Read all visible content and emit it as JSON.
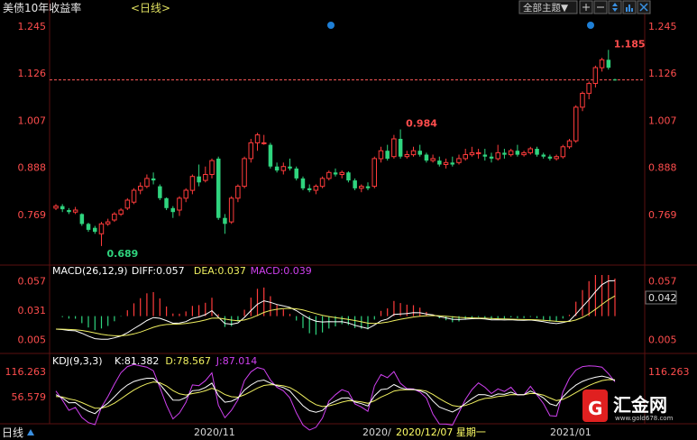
{
  "header": {
    "title": "美债10年收益率",
    "period": "<日线>",
    "theme_button": "全部主题▼",
    "period_label": "日线"
  },
  "colors": {
    "up": "#ff3b3b",
    "down": "#2fd47e",
    "axis_red": "#ff4d4d",
    "macd_yellow": "#f0f060",
    "macd_pink": "#e040fb",
    "k_white": "#ffffff",
    "d_yellow": "#f0f060",
    "j_purple": "#d040f0",
    "dashed_red": "#ff5a5a",
    "grid": "#3a0a0a",
    "marker_blue": "#1e7fd6"
  },
  "chart_data": [
    {
      "type": "candlestick",
      "title": "美债10年收益率",
      "yticks": [
        "1.245",
        "1.126",
        "1.007",
        "0.888",
        "0.769"
      ],
      "ylim": [
        0.65,
        1.27
      ],
      "current_line": 1.109,
      "current_label": "1.126",
      "annotations": [
        {
          "label": "0.689",
          "value": 0.689
        },
        {
          "label": "0.984",
          "value": 0.984
        },
        {
          "label": "1.185",
          "value": 1.185
        }
      ],
      "candles": [
        [
          0.785,
          0.79,
          0.795,
          0.78
        ],
        [
          0.79,
          0.782,
          0.795,
          0.775
        ],
        [
          0.78,
          0.775,
          0.785,
          0.77
        ],
        [
          0.775,
          0.78,
          0.788,
          0.77
        ],
        [
          0.77,
          0.745,
          0.772,
          0.74
        ],
        [
          0.745,
          0.73,
          0.748,
          0.725
        ],
        [
          0.735,
          0.725,
          0.74,
          0.72
        ],
        [
          0.72,
          0.745,
          0.75,
          0.689
        ],
        [
          0.745,
          0.75,
          0.758,
          0.74
        ],
        [
          0.755,
          0.77,
          0.775,
          0.75
        ],
        [
          0.77,
          0.78,
          0.785,
          0.765
        ],
        [
          0.785,
          0.805,
          0.81,
          0.78
        ],
        [
          0.8,
          0.83,
          0.835,
          0.795
        ],
        [
          0.83,
          0.84,
          0.85,
          0.82
        ],
        [
          0.84,
          0.86,
          0.87,
          0.835
        ],
        [
          0.86,
          0.855,
          0.875,
          0.845
        ],
        [
          0.84,
          0.81,
          0.845,
          0.805
        ],
        [
          0.81,
          0.785,
          0.812,
          0.78
        ],
        [
          0.785,
          0.775,
          0.79,
          0.76
        ],
        [
          0.78,
          0.81,
          0.815,
          0.765
        ],
        [
          0.81,
          0.83,
          0.835,
          0.8
        ],
        [
          0.83,
          0.865,
          0.87,
          0.82
        ],
        [
          0.865,
          0.85,
          0.895,
          0.84
        ],
        [
          0.855,
          0.87,
          0.89,
          0.85
        ],
        [
          0.87,
          0.905,
          0.91,
          0.86
        ],
        [
          0.91,
          0.76,
          0.915,
          0.755
        ],
        [
          0.76,
          0.745,
          0.77,
          0.72
        ],
        [
          0.75,
          0.81,
          0.815,
          0.745
        ],
        [
          0.81,
          0.84,
          0.845,
          0.8
        ],
        [
          0.84,
          0.91,
          0.915,
          0.835
        ],
        [
          0.91,
          0.95,
          0.96,
          0.9
        ],
        [
          0.95,
          0.97,
          0.975,
          0.93
        ],
        [
          0.95,
          0.95,
          0.97,
          0.945
        ],
        [
          0.945,
          0.89,
          0.95,
          0.885
        ],
        [
          0.89,
          0.88,
          0.9,
          0.875
        ],
        [
          0.88,
          0.89,
          0.9,
          0.87
        ],
        [
          0.89,
          0.885,
          0.91,
          0.88
        ],
        [
          0.885,
          0.86,
          0.89,
          0.855
        ],
        [
          0.86,
          0.835,
          0.865,
          0.83
        ],
        [
          0.835,
          0.83,
          0.845,
          0.825
        ],
        [
          0.83,
          0.84,
          0.845,
          0.82
        ],
        [
          0.84,
          0.86,
          0.865,
          0.835
        ],
        [
          0.86,
          0.875,
          0.88,
          0.855
        ],
        [
          0.875,
          0.87,
          0.885,
          0.865
        ],
        [
          0.87,
          0.875,
          0.88,
          0.86
        ],
        [
          0.875,
          0.855,
          0.878,
          0.85
        ],
        [
          0.855,
          0.835,
          0.86,
          0.83
        ],
        [
          0.835,
          0.84,
          0.845,
          0.825
        ],
        [
          0.84,
          0.835,
          0.85,
          0.83
        ],
        [
          0.84,
          0.91,
          0.915,
          0.835
        ],
        [
          0.91,
          0.93,
          0.94,
          0.9
        ],
        [
          0.93,
          0.91,
          0.945,
          0.905
        ],
        [
          0.915,
          0.96,
          0.97,
          0.91
        ],
        [
          0.96,
          0.915,
          0.984,
          0.91
        ],
        [
          0.915,
          0.92,
          0.93,
          0.91
        ],
        [
          0.92,
          0.93,
          0.94,
          0.915
        ],
        [
          0.93,
          0.92,
          0.945,
          0.915
        ],
        [
          0.92,
          0.905,
          0.925,
          0.9
        ],
        [
          0.905,
          0.91,
          0.92,
          0.9
        ],
        [
          0.905,
          0.895,
          0.915,
          0.89
        ],
        [
          0.895,
          0.9,
          0.91,
          0.885
        ],
        [
          0.9,
          0.895,
          0.915,
          0.89
        ],
        [
          0.9,
          0.91,
          0.92,
          0.895
        ],
        [
          0.91,
          0.92,
          0.935,
          0.905
        ],
        [
          0.92,
          0.925,
          0.94,
          0.915
        ],
        [
          0.925,
          0.925,
          0.935,
          0.91
        ],
        [
          0.92,
          0.915,
          0.935,
          0.905
        ],
        [
          0.915,
          0.91,
          0.925,
          0.9
        ],
        [
          0.91,
          0.925,
          0.945,
          0.905
        ],
        [
          0.925,
          0.92,
          0.935,
          0.91
        ],
        [
          0.92,
          0.93,
          0.935,
          0.915
        ],
        [
          0.93,
          0.92,
          0.945,
          0.915
        ],
        [
          0.92,
          0.925,
          0.93,
          0.915
        ],
        [
          0.925,
          0.935,
          0.94,
          0.92
        ],
        [
          0.935,
          0.92,
          0.94,
          0.915
        ],
        [
          0.92,
          0.915,
          0.925,
          0.91
        ],
        [
          0.915,
          0.91,
          0.92,
          0.905
        ],
        [
          0.91,
          0.915,
          0.92,
          0.905
        ],
        [
          0.915,
          0.94,
          0.945,
          0.91
        ],
        [
          0.94,
          0.955,
          0.96,
          0.935
        ],
        [
          0.955,
          1.04,
          1.045,
          0.95
        ],
        [
          1.04,
          1.075,
          1.08,
          1.03
        ],
        [
          1.075,
          1.1,
          1.105,
          1.06
        ],
        [
          1.1,
          1.14,
          1.145,
          1.09
        ],
        [
          1.14,
          1.16,
          1.165,
          1.13
        ],
        [
          1.16,
          1.14,
          1.185,
          1.135
        ],
        [
          1.11,
          1.109,
          1.112,
          1.107
        ]
      ]
    },
    {
      "type": "line",
      "title": "MACD",
      "legend": [
        {
          "label": "MACD(26,12,9)",
          "color_key": "k_white"
        },
        {
          "label": "DIFF:0.057",
          "color_key": "k_white"
        },
        {
          "label": "DEA:0.037",
          "color_key": "d_yellow"
        },
        {
          "label": "MACD:0.039",
          "color_key": "j_purple"
        }
      ],
      "yticks": [
        "0.057",
        "0.031",
        "0.005"
      ],
      "right_labels": [
        "0.057",
        "0.042",
        "0.005"
      ],
      "ylim": [
        -0.002,
        0.062
      ]
    },
    {
      "type": "line",
      "title": "KDJ",
      "legend": [
        {
          "label": "KDJ(9,3,3)",
          "color_key": "k_white"
        },
        {
          "label": "K:81.382",
          "color_key": "k_white"
        },
        {
          "label": "D:78.567",
          "color_key": "d_yellow"
        },
        {
          "label": "J:87.014",
          "color_key": "j_purple"
        }
      ],
      "yticks": [
        "116.263",
        "56.579"
      ],
      "right_labels": [
        "116.263"
      ]
    }
  ],
  "xaxis": {
    "labels": [
      "2020/11",
      "2020/",
      "2020/12/07 星期一",
      "2021/01"
    ]
  },
  "watermark": {
    "brand": "汇金网",
    "url": "www.gold678.com"
  }
}
